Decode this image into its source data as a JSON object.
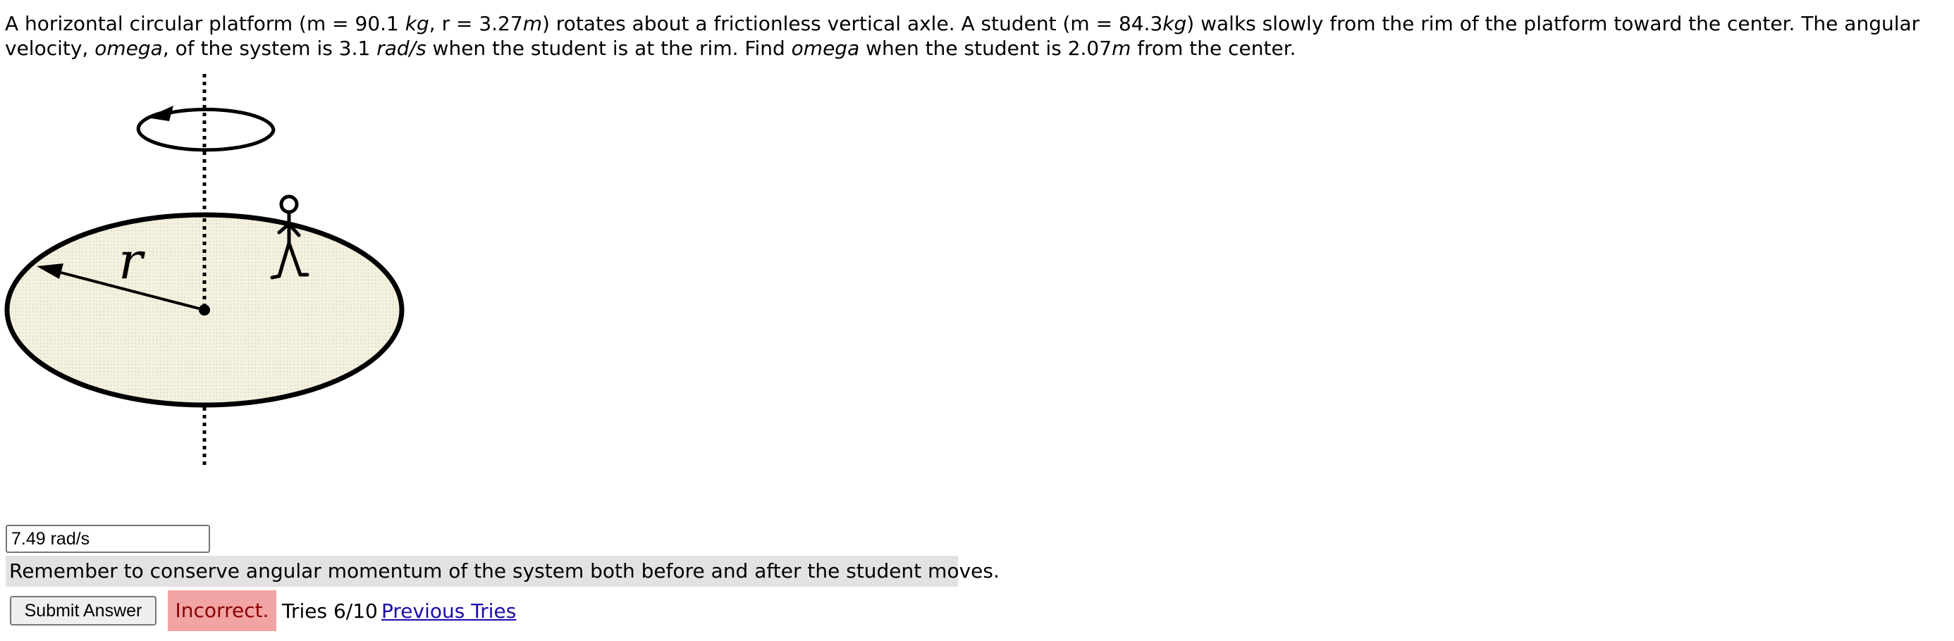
{
  "problem": {
    "p1": "A horizontal circular platform (m = 90.1 ",
    "u_kg": "kg",
    "p2": ", r = 3.27",
    "u_m": "m",
    "p3": ") rotates about a frictionless vertical axle. A student (m = 84.3",
    "u_kg2": "kg",
    "p4": ") walks slowly from the rim of the platform toward the center. The angular velocity, ",
    "omega1": "omega",
    "p5": ", of the system is 3.1 ",
    "u_rads": "rad/s",
    "p6": " when the student is at the rim. Find ",
    "omega2": "omega",
    "p7": " when the student is 2.07",
    "u_m2": "m",
    "p8": " from the center."
  },
  "figure": {
    "radius_label": "r"
  },
  "answer": {
    "value": "7.49 rad/s"
  },
  "hint": {
    "text": "Remember to conserve angular momentum of the system both before and after the student moves."
  },
  "submit": {
    "label": "Submit Answer"
  },
  "status": {
    "label": "Incorrect."
  },
  "tries": {
    "text": "Tries 6/10"
  },
  "previous": {
    "label": "Previous Tries"
  },
  "colors": {
    "incorrect_bg": "#f2a4a4",
    "hint_bg": "#e2e2e2",
    "link": "#1a0dab",
    "platform_fill": "#f4f1e0"
  }
}
